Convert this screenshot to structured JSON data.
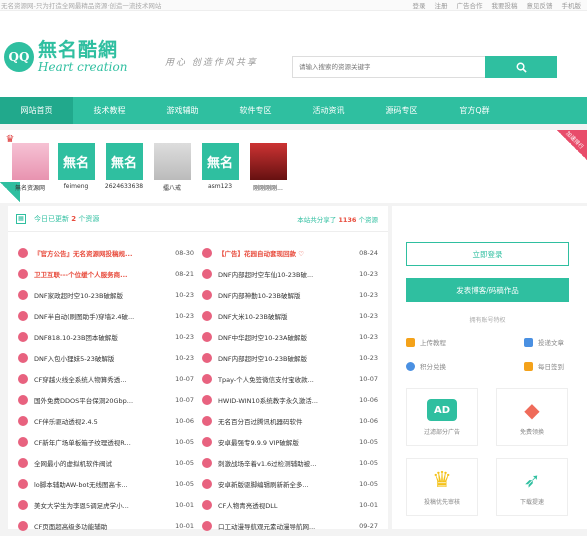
{
  "topbar": {
    "left": "无名资源网-只为打造全网最精品资源·创造一流技术网站",
    "links": [
      "登录",
      "注册",
      "广告合作",
      "我要投稿",
      "意见反馈",
      "手机版"
    ]
  },
  "header": {
    "logo_circle": "QQ",
    "logo_cn": "無名酷網",
    "logo_en": "Heart creation",
    "slogan": "用心 创造作风共享",
    "search_placeholder": "请输入搜索的资源关键字"
  },
  "nav": [
    "网站首页",
    "技术教程",
    "游戏辅助",
    "软件专区",
    "活动资讯",
    "源码专区",
    "官方Q群"
  ],
  "users": [
    {
      "name": "無名资源网",
      "avatar": "",
      "crown": "red"
    },
    {
      "name": "feimeng",
      "avatar": "無名",
      "crown": "yellow"
    },
    {
      "name": "2624633638",
      "avatar": "無名",
      "crown": "green"
    },
    {
      "name": "擂八戒",
      "avatar": "",
      "crown": "black"
    },
    {
      "name": "asm123",
      "avatar": "無名",
      "crown": ""
    },
    {
      "name": "刚刚刚刚...",
      "avatar": "",
      "crown": ""
    }
  ],
  "ribbon_right": "加速排行",
  "ribbon_left": "今日",
  "main": {
    "today_label_pre": "今日已更新",
    "today_count": "2",
    "today_label_post": "个资源",
    "share_pre": "本站共分享了",
    "share_count": "1136",
    "share_post": "个资源",
    "left_col": [
      {
        "title": "『官方公告』无名资源网投稿规...",
        "date": "08-30",
        "red": true
      },
      {
        "title": "卫卫互联---个位缓个人服务商...",
        "date": "08-21",
        "red": true
      },
      {
        "title": "DNF家政超时空10-23B破解版",
        "date": "10-23",
        "red": false
      },
      {
        "title": "DNF半自动(刷图助手)穿墙2.4破...",
        "date": "10-23",
        "red": false
      },
      {
        "title": "DNF818.10-23B团本破解版",
        "date": "10-23",
        "red": false
      },
      {
        "title": "DNF入包小狸妹5-23破解版",
        "date": "10-23",
        "red": false
      },
      {
        "title": "CF穿越火线全系统人物算秀透...",
        "date": "10-07",
        "red": false
      },
      {
        "title": "国外免费DDOS平台保洞20Gbp...",
        "date": "10-07",
        "red": false
      },
      {
        "title": "CF伴乐驱动透视2.4.5",
        "date": "10-06",
        "red": false
      },
      {
        "title": "CF新年广场单板箱子纹理透视R...",
        "date": "10-05",
        "red": false
      },
      {
        "title": "全网最小的虚拟机软件阀试",
        "date": "10-05",
        "red": false
      },
      {
        "title": "lo脚本辅助AW-bot无线图高卡...",
        "date": "10-05",
        "red": false
      },
      {
        "title": "美女大学生为李恩5调足虎学小...",
        "date": "10-01",
        "red": false
      },
      {
        "title": "CF页面超高级多功能辅助",
        "date": "10-01",
        "red": false
      }
    ],
    "right_col": [
      {
        "title": "【广告】花园自动套现回款 ♡",
        "date": "08-24",
        "red": true
      },
      {
        "title": "DNF内部超时空车仙10-23B破...",
        "date": "10-23",
        "red": false
      },
      {
        "title": "DNF内部神勤10-23B破解版",
        "date": "10-23",
        "red": false
      },
      {
        "title": "DNF大米10-23B破解版",
        "date": "10-23",
        "red": false
      },
      {
        "title": "DNF中华超时空10-23A破解版",
        "date": "10-23",
        "red": false
      },
      {
        "title": "DNF内部超时空10-23B破解版",
        "date": "10-23",
        "red": false
      },
      {
        "title": "Tpay-个人免签微信支付宝收款...",
        "date": "10-07",
        "red": false
      },
      {
        "title": "HWID-WIN10系统教字永久激活...",
        "date": "10-06",
        "red": false
      },
      {
        "title": "无名百分百过腾讯机器码软件",
        "date": "10-06",
        "red": false
      },
      {
        "title": "安卓最强专9.9.9 VIP破解版",
        "date": "10-05",
        "red": false
      },
      {
        "title": "刺激战场辛着v1.6过检测辅助被...",
        "date": "10-05",
        "red": false
      },
      {
        "title": "安卓新版驱脚编辑刷新新全多...",
        "date": "10-05",
        "red": false
      },
      {
        "title": "CF人物青亮透视DLL",
        "date": "10-01",
        "red": false
      },
      {
        "title": "口工动漫导航观元素动漫导航网...",
        "date": "09-27",
        "red": false
      }
    ]
  },
  "side": {
    "login": "立即登录",
    "publish": "发表博客/码稿作品",
    "divider": "拥有账号特权",
    "privileges": [
      "上传教程",
      "投递文章",
      "积分兑换",
      "每日签到"
    ],
    "cards": [
      {
        "label": "过滤部分广告",
        "pic": "AD",
        "color": "#2fbfa0"
      },
      {
        "label": "免费领换",
        "pic": "◆",
        "color": "#ef6b5a"
      },
      {
        "label": "投稿优先审核",
        "pic": "♛",
        "color": "#f4c21a"
      },
      {
        "label": "下载提速",
        "pic": "➶",
        "color": "#2fbfa0"
      }
    ]
  }
}
